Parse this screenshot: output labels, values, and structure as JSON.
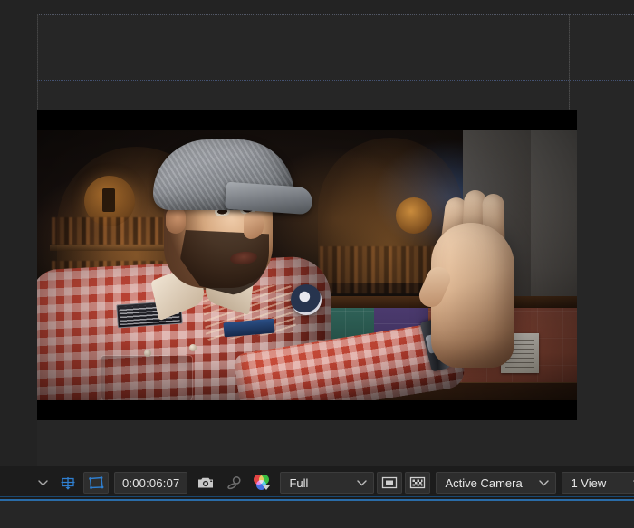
{
  "panel": {
    "name": "Composition Viewer",
    "background_color": "#262626",
    "accent_color": "#2a6ca8"
  },
  "canvas": {
    "name": "composition-canvas",
    "guides_visible": true,
    "guide_color": "#5a6070",
    "comp_bounds_color": "#3a3a3a",
    "letterbox_color": "#000000",
    "frame": {
      "description": "Video frame of a man wearing a grey flat cap and a red-and-white checked shirt with embroidered patches, holding his right hand up, palm forward, in front of a dimly lit shop interior with arched alcoves, shelves of bottles and a tiled counter back-wall.",
      "letterboxed": true
    }
  },
  "toolbar": {
    "name": "viewer-toolbar",
    "always_preview_this_view_label": "",
    "items": [
      {
        "type": "caret",
        "name": "magnification-caret",
        "icon": "chevron-down-icon"
      },
      {
        "type": "button",
        "name": "choose-grid-and-guide-options",
        "icon": "grid-guide-icon"
      },
      {
        "type": "button",
        "name": "region-of-interest-toggle",
        "icon": "region-of-interest-icon"
      },
      {
        "type": "field",
        "name": "current-time-field",
        "value": "0:00:06:07"
      },
      {
        "type": "button",
        "name": "take-snapshot",
        "icon": "camera-icon"
      },
      {
        "type": "button",
        "name": "show-snapshot",
        "icon": "show-snapshot-icon"
      },
      {
        "type": "button",
        "name": "show-channel-and-color-management",
        "icon": "rgb-channels-icon"
      },
      {
        "type": "select",
        "name": "resolution-select",
        "value": "Full"
      },
      {
        "type": "button",
        "name": "toggle-mask-and-shape-path-visibility",
        "icon": "mask-visibility-icon"
      },
      {
        "type": "button",
        "name": "toggle-transparency-grid",
        "icon": "transparency-grid-icon"
      },
      {
        "type": "select",
        "name": "camera-view-select",
        "value": "Active Camera"
      },
      {
        "type": "select",
        "name": "view-layout-select",
        "value": "1 View"
      },
      {
        "type": "button",
        "name": "pixel-aspect-ratio-correction",
        "icon": "pixel-aspect-icon"
      },
      {
        "type": "button",
        "name": "fast-previews",
        "icon": "fast-previews-icon"
      }
    ],
    "timecode": "0:00:06:07",
    "resolution": "Full",
    "camera_view": "Active Camera",
    "view_layout": "1 View"
  }
}
